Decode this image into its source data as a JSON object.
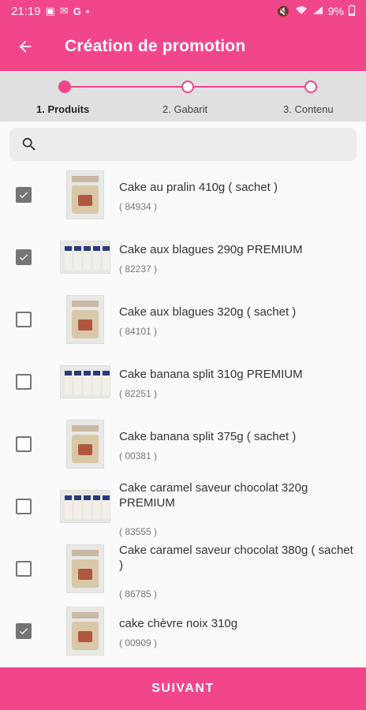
{
  "status_bar": {
    "time": "21:19",
    "left_icons": [
      "image-icon",
      "mail-icon",
      "google-icon",
      "dot-icon"
    ],
    "battery": "9%"
  },
  "app_bar": {
    "title": "Création de promotion"
  },
  "stepper": {
    "steps": [
      {
        "label": "1. Produits",
        "state": "done"
      },
      {
        "label": "2. Gabarit",
        "state": "todo"
      },
      {
        "label": "3. Contenu",
        "state": "todo"
      }
    ]
  },
  "search": {
    "placeholder": "",
    "value": ""
  },
  "products": [
    {
      "name": "Cake au pralin 410g ( sachet )",
      "code": "( 84934 )",
      "checked": true,
      "thumb": "bag"
    },
    {
      "name": "Cake aux blagues 290g PREMIUM",
      "code": "( 82237 )",
      "checked": true,
      "thumb": "box"
    },
    {
      "name": "Cake aux blagues 320g ( sachet )",
      "code": "( 84101 )",
      "checked": false,
      "thumb": "bag"
    },
    {
      "name": "Cake banana split 310g PREMIUM",
      "code": "( 82251 )",
      "checked": false,
      "thumb": "box"
    },
    {
      "name": "Cake banana split 375g ( sachet )",
      "code": "( 00381 )",
      "checked": false,
      "thumb": "bag"
    },
    {
      "name": "Cake caramel saveur chocolat 320g PREMIUM",
      "code": "( 83555 )",
      "checked": false,
      "thumb": "box"
    },
    {
      "name": "Cake caramel saveur chocolat 380g ( sachet )",
      "code": "( 86785 )",
      "checked": false,
      "thumb": "bag"
    },
    {
      "name": "cake chèvre noix 310g",
      "code": "( 00909 )",
      "checked": true,
      "thumb": "bag"
    }
  ],
  "footer": {
    "next_label": "SUIVANT"
  },
  "colors": {
    "accent": "#f2468b",
    "checkbox": "#757575",
    "stepper_bg": "#e0e0e0"
  }
}
